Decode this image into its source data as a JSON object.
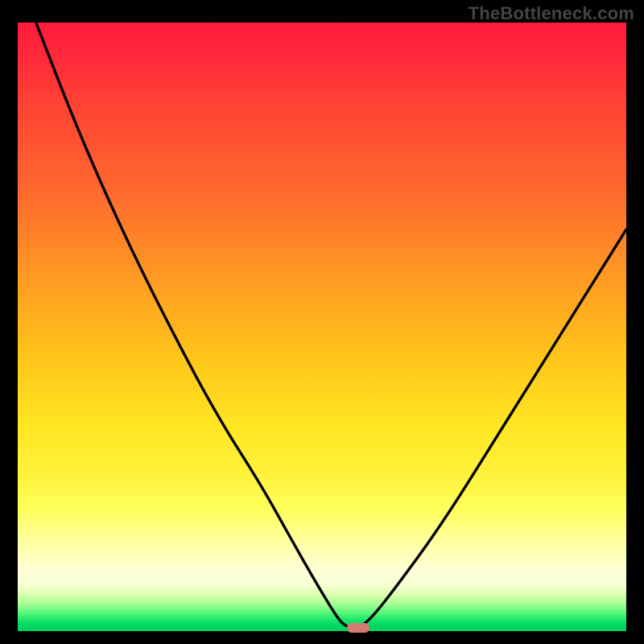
{
  "watermark": "TheBottleneck.com",
  "colors": {
    "background": "#000000",
    "curve": "#000000",
    "marker": "#d67a74",
    "gradient_top": "#ff1a3a",
    "gradient_mid": "#ffe522",
    "gradient_bottom": "#00d05e"
  },
  "chart_data": {
    "type": "line",
    "title": "",
    "xlabel": "",
    "ylabel": "",
    "xlim": [
      0,
      100
    ],
    "ylim": [
      0,
      100
    ],
    "grid": false,
    "series": [
      {
        "name": "bottleneck-curve",
        "x": [
          3,
          10,
          18,
          26,
          33,
          40,
          45,
          49,
          52,
          53.5,
          55,
          56,
          58,
          62,
          70,
          80,
          90,
          100
        ],
        "values": [
          100,
          82,
          64,
          48,
          35,
          24,
          15,
          8,
          3,
          1,
          0.5,
          0.5,
          2,
          7,
          18,
          34,
          50,
          66
        ]
      }
    ],
    "marker": {
      "x": 56,
      "y": 0.5
    }
  }
}
